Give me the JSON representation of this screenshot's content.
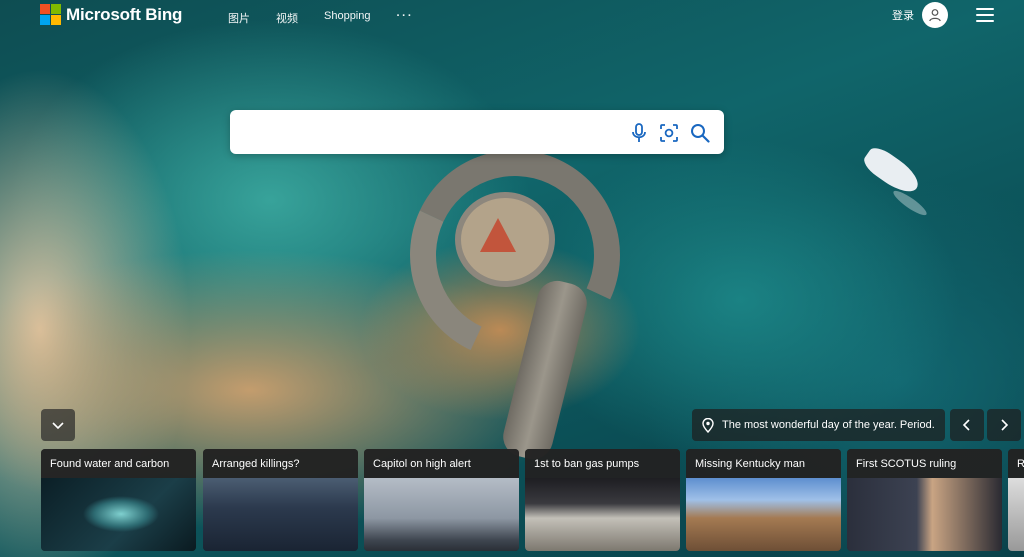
{
  "brand": {
    "name": "Microsoft Bing",
    "logo_colors": [
      "#f25022",
      "#7fba00",
      "#00a4ef",
      "#ffb900"
    ]
  },
  "nav": {
    "items": [
      "图片",
      "视频",
      "Shopping"
    ],
    "more_label": "···"
  },
  "account": {
    "signin_label": "登录",
    "avatar_icon": "person-icon"
  },
  "menu_icon": "hamburger-menu-icon",
  "search": {
    "value": "",
    "icons": [
      "microphone-icon",
      "visual-search-icon",
      "search-icon"
    ]
  },
  "background": {
    "collapse_icon": "chevron-down-icon",
    "info_icon": "location-pin-icon",
    "caption": "The most wonderful day of the year. Period.",
    "prev_icon": "chevron-left-icon",
    "next_icon": "chevron-right-icon"
  },
  "news": [
    {
      "title": "Found water and carbon"
    },
    {
      "title": "Arranged killings?"
    },
    {
      "title": "Capitol on high alert"
    },
    {
      "title": "1st to ban gas pumps"
    },
    {
      "title": "Missing Kentucky man"
    },
    {
      "title": "First SCOTUS ruling"
    },
    {
      "title": "R"
    }
  ]
}
